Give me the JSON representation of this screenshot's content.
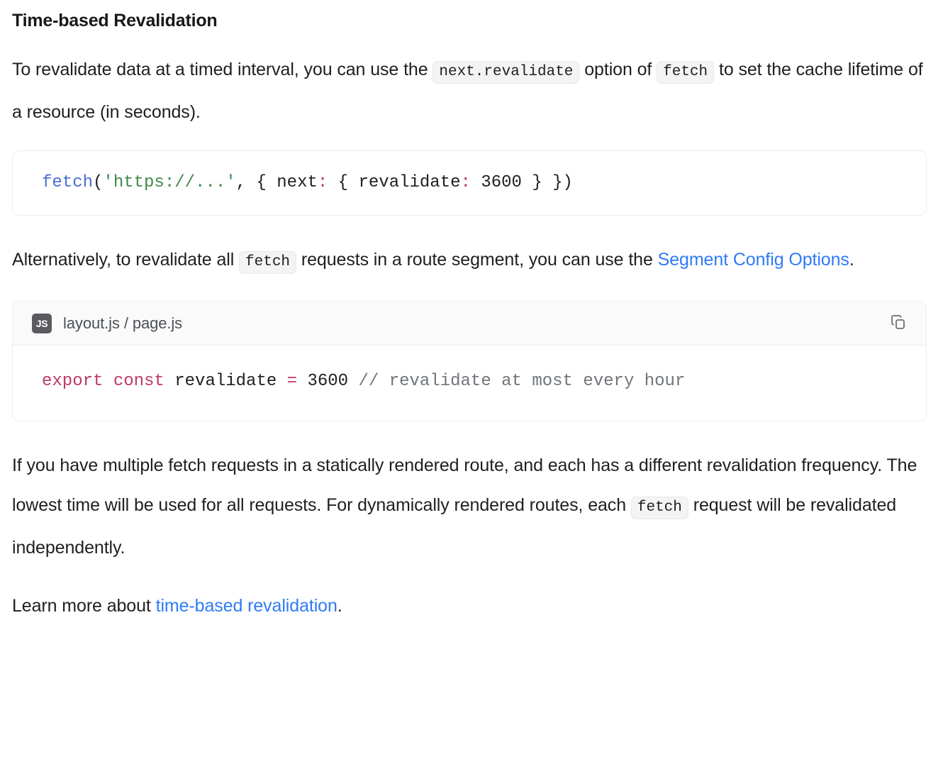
{
  "section": {
    "title": "Time-based Revalidation"
  },
  "paragraph1": {
    "part1": "To revalidate data at a timed interval, you can use the ",
    "code1": "next.revalidate",
    "part2": " option of ",
    "code2": "fetch",
    "part3": " to set the cache lifetime of a resource (in seconds)."
  },
  "code_block_1": {
    "tokens": [
      {
        "text": "fetch",
        "kind": "fn"
      },
      {
        "text": "(",
        "kind": "punct"
      },
      {
        "text": "'https://...'",
        "kind": "string"
      },
      {
        "text": ", { next",
        "kind": "punct"
      },
      {
        "text": ":",
        "kind": "colon"
      },
      {
        "text": " { revalidate",
        "kind": "punct"
      },
      {
        "text": ":",
        "kind": "colon"
      },
      {
        "text": " ",
        "kind": "punct"
      },
      {
        "text": "3600",
        "kind": "number"
      },
      {
        "text": " } })",
        "kind": "punct"
      }
    ],
    "plain_text": "fetch('https://...', { next: { revalidate: 3600 } })"
  },
  "paragraph2": {
    "part1": "Alternatively, to revalidate all ",
    "code1": "fetch",
    "part2": " requests in a route segment, you can use the ",
    "link": "Segment Config Options",
    "part3": "."
  },
  "code_block_2": {
    "header": {
      "badge_label": "JS",
      "file_name": "layout.js / page.js",
      "copy_icon": "copy-icon"
    },
    "tokens": [
      {
        "text": "export const",
        "kind": "keyword"
      },
      {
        "text": " revalidate ",
        "kind": "punct"
      },
      {
        "text": "=",
        "kind": "op"
      },
      {
        "text": " ",
        "kind": "punct"
      },
      {
        "text": "3600",
        "kind": "number"
      },
      {
        "text": " ",
        "kind": "punct"
      },
      {
        "text": "// revalidate at most every hour",
        "kind": "comment"
      }
    ],
    "plain_text": "export const revalidate = 3600 // revalidate at most every hour"
  },
  "paragraph3": {
    "part1": "If you have multiple fetch requests in a statically rendered route, and each has a different revalidation frequency. The lowest time will be used for all requests. For dynamically rendered routes, each ",
    "code1": "fetch",
    "part2": " request will be revalidated independently."
  },
  "paragraph4": {
    "part1": "Learn more about ",
    "link": "time-based revalidation",
    "part2": "."
  },
  "colors": {
    "text": "#1f1f22",
    "heading": "#18181b",
    "link": "#2f7bf6",
    "code_fn": "#4a6ed0",
    "code_string": "#3f8a46",
    "code_keyword": "#bd3a63",
    "code_comment": "#70757a",
    "inline_code_bg": "#f4f4f5",
    "code_header_bg": "#fafafa",
    "badge_bg": "#5b5b5f",
    "border": "#ededf0"
  }
}
